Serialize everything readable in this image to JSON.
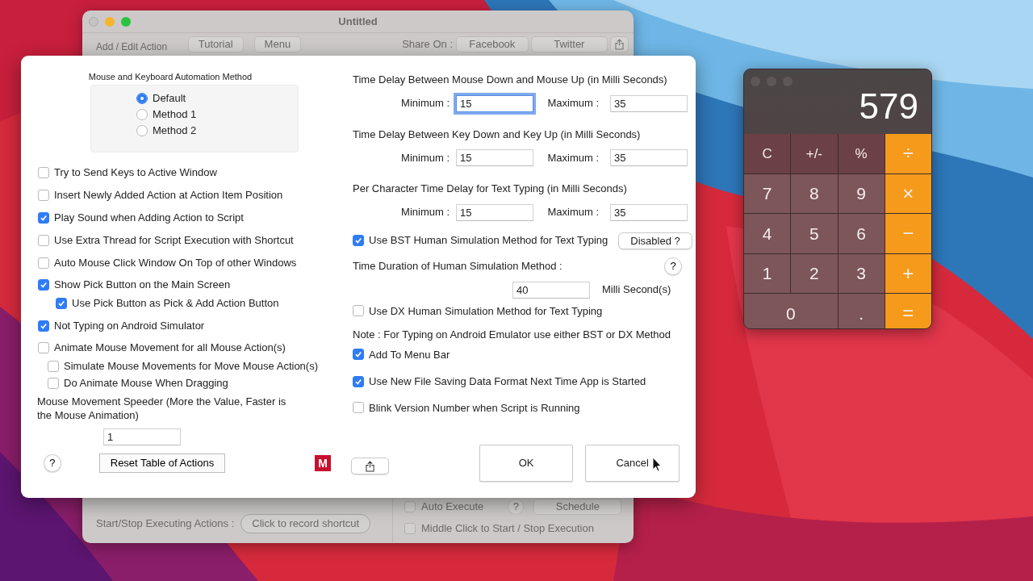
{
  "main_window": {
    "title": "Untitled",
    "toolbar": {
      "label": "Add / Edit Action",
      "buttons": [
        "Tutorial",
        "Menu"
      ],
      "share_label": "Share On :",
      "share_buttons": [
        "Facebook",
        "Twitter"
      ]
    },
    "footer": {
      "shortcut_label": "Start/Stop Executing Actions :",
      "shortcut_button": "Click to record shortcut",
      "auto_execute": {
        "label": "Auto Execute",
        "checked": false
      },
      "help": "?",
      "schedule": "Schedule",
      "middle_click": {
        "label": "Middle Click to Start / Stop Execution",
        "checked": false
      }
    }
  },
  "dialog": {
    "method_group": {
      "title": "Mouse and Keyboard Automation Method",
      "options": [
        {
          "label": "Default",
          "selected": true
        },
        {
          "label": "Method 1",
          "selected": false
        },
        {
          "label": "Method 2",
          "selected": false
        }
      ]
    },
    "left_options": [
      {
        "label": "Try to Send Keys to Active Window",
        "checked": false
      },
      {
        "label": "Insert Newly Added Action at Action Item Position",
        "checked": false
      },
      {
        "label": "Play Sound when Adding Action to Script",
        "checked": true
      },
      {
        "label": "Use Extra Thread for Script Execution with Shortcut",
        "checked": false
      },
      {
        "label": "Auto Mouse Click Window On Top of other Windows",
        "checked": false
      },
      {
        "label": "Show Pick Button on the Main Screen",
        "checked": true,
        "children": [
          {
            "label": "Use Pick Button as Pick & Add Action Button",
            "checked": true
          }
        ]
      },
      {
        "label": "Not Typing on Android Simulator",
        "checked": true
      },
      {
        "label": "Animate Mouse Movement for all Mouse Action(s)",
        "checked": false,
        "children": [
          {
            "label": "Simulate Mouse Movements for Move Mouse Action(s)",
            "checked": false
          },
          {
            "label": "Do Animate Mouse When Dragging",
            "checked": false
          }
        ]
      }
    ],
    "speeder": {
      "label": "Mouse Movement Speeder (More the Value, Faster is the Mouse Animation)",
      "value": "1"
    },
    "help": "?",
    "reset_button": "Reset Table of Actions",
    "logo_text": "M",
    "delays": [
      {
        "title": "Time Delay Between Mouse Down and Mouse Up (in Milli Seconds)",
        "min_label": "Minimum :",
        "min": "15",
        "max_label": "Maximum :",
        "max": "35",
        "focused": true
      },
      {
        "title": "Time Delay Between Key Down and Key Up (in Milli Seconds)",
        "min_label": "Minimum :",
        "min": "15",
        "max_label": "Maximum :",
        "max": "35",
        "focused": false
      },
      {
        "title": "Per Character Time Delay  for Text Typing (in Milli Seconds)",
        "min_label": "Minimum :",
        "min": "15",
        "max_label": "Maximum :",
        "max": "35",
        "focused": false
      }
    ],
    "bst": {
      "label": "Use BST Human Simulation Method for Text Typing",
      "checked": true,
      "button": "Disabled ?"
    },
    "duration": {
      "label": "Time Duration of Human Simulation Method :",
      "help": "?",
      "value": "40",
      "unit": "Milli Second(s)"
    },
    "dx": {
      "label": "Use DX Human Simulation Method for Text Typing",
      "checked": false
    },
    "note": "Note : For Typing on Android Emulator use either BST or DX Method",
    "right_options": [
      {
        "label": "Add To Menu Bar",
        "checked": true
      },
      {
        "label": "Use New File Saving Data Format Next Time App is Started",
        "checked": true
      },
      {
        "label": "Blink Version Number when Script is Running",
        "checked": false
      }
    ],
    "buttons": [
      "OK",
      "Cancel"
    ]
  },
  "calculator": {
    "display": "579",
    "keys": [
      {
        "label": "C",
        "kind": "function"
      },
      {
        "label": "+/-",
        "kind": "function"
      },
      {
        "label": "%",
        "kind": "function"
      },
      {
        "label": "÷",
        "kind": "operator"
      },
      {
        "label": "7",
        "kind": "digit"
      },
      {
        "label": "8",
        "kind": "digit"
      },
      {
        "label": "9",
        "kind": "digit"
      },
      {
        "label": "×",
        "kind": "operator"
      },
      {
        "label": "4",
        "kind": "digit"
      },
      {
        "label": "5",
        "kind": "digit"
      },
      {
        "label": "6",
        "kind": "digit"
      },
      {
        "label": "−",
        "kind": "operator"
      },
      {
        "label": "1",
        "kind": "digit"
      },
      {
        "label": "2",
        "kind": "digit"
      },
      {
        "label": "3",
        "kind": "digit"
      },
      {
        "label": "+",
        "kind": "operator"
      },
      {
        "label": "0",
        "kind": "wide"
      },
      {
        "label": ".",
        "kind": "digit"
      },
      {
        "label": "=",
        "kind": "operator"
      }
    ]
  }
}
